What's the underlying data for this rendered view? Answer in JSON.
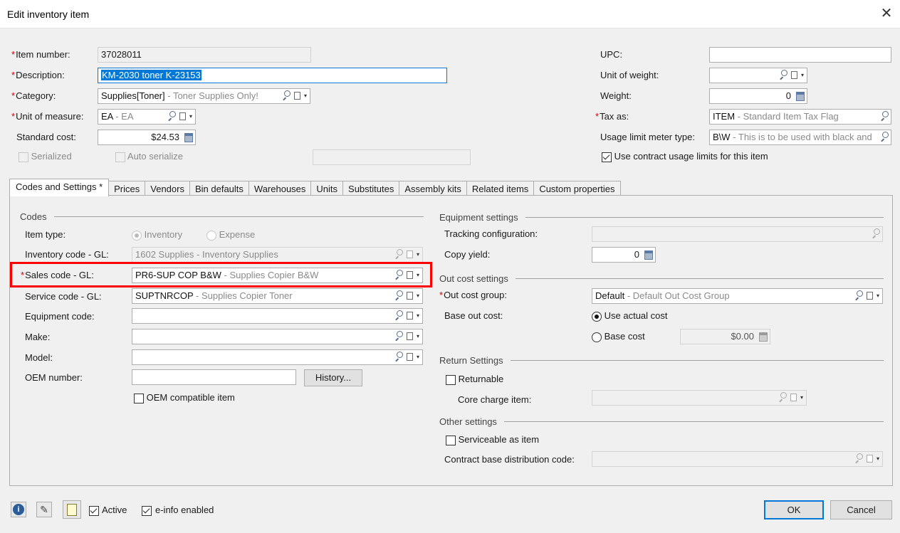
{
  "window": {
    "title": "Edit inventory item",
    "close_label": "✕"
  },
  "header": {
    "item_number": {
      "label": "Item number:",
      "value": "37028011"
    },
    "description": {
      "label": "Description:",
      "value": "KM-2030 toner  K-23153"
    },
    "category": {
      "label": "Category:",
      "code": "Supplies[Toner]",
      "desc": " - Toner Supplies Only!"
    },
    "unit_of_measure": {
      "label": "Unit of measure:",
      "code": "EA",
      "desc": " - EA"
    },
    "standard_cost": {
      "label": "Standard cost:",
      "value": "$24.53"
    },
    "serialized": {
      "label": "Serialized"
    },
    "auto_serialize": {
      "label": "Auto serialize"
    },
    "upc": {
      "label": "UPC:",
      "value": ""
    },
    "unit_of_weight": {
      "label": "Unit of weight:",
      "value": ""
    },
    "weight": {
      "label": "Weight:",
      "value": "0"
    },
    "tax_as": {
      "label": "Tax as:",
      "code": "ITEM",
      "desc": " - Standard Item Tax Flag"
    },
    "usage_limit_meter_type": {
      "label": "Usage limit meter type:",
      "code": "B\\W",
      "desc": " - This is to be used with black and"
    },
    "use_contract_usage": {
      "label": "Use contract usage limits for this item",
      "checked": true
    }
  },
  "tabs": [
    {
      "label": "Codes and Settings *",
      "active": true
    },
    {
      "label": "Prices"
    },
    {
      "label": "Vendors"
    },
    {
      "label": "Bin defaults"
    },
    {
      "label": "Warehouses"
    },
    {
      "label": "Units"
    },
    {
      "label": "Substitutes"
    },
    {
      "label": "Assembly kits"
    },
    {
      "label": "Related items"
    },
    {
      "label": "Custom properties"
    }
  ],
  "codes": {
    "group_label": "Codes",
    "item_type": {
      "label": "Item type:",
      "inventory": "Inventory",
      "expense": "Expense"
    },
    "inventory_code": {
      "label": "Inventory code - GL:",
      "code": "1602 Supplies",
      "desc": " - Inventory Supplies"
    },
    "sales_code": {
      "label": "Sales code - GL:",
      "code": "PR6-SUP COP B&W",
      "desc": " - Supplies Copier B&W"
    },
    "service_code": {
      "label": "Service code - GL:",
      "code": "SUPTNRCOP",
      "desc": " - Supplies Copier Toner"
    },
    "equipment_code": {
      "label": "Equipment code:",
      "value": ""
    },
    "make": {
      "label": "Make:",
      "value": ""
    },
    "model": {
      "label": "Model:",
      "value": ""
    },
    "oem_number": {
      "label": "OEM number:",
      "value": ""
    },
    "history_button": "History...",
    "oem_compatible": {
      "label": "OEM compatible item",
      "checked": false
    }
  },
  "equipment": {
    "group_label": "Equipment settings",
    "tracking_configuration": {
      "label": "Tracking configuration:",
      "value": ""
    },
    "copy_yield": {
      "label": "Copy yield:",
      "value": "0"
    }
  },
  "out_cost": {
    "group_label": "Out cost settings",
    "out_cost_group": {
      "label": "Out cost group:",
      "code": "Default",
      "desc": " - Default Out Cost Group"
    },
    "base_out_cost": {
      "label": "Base out cost:"
    },
    "use_actual_cost": {
      "label": "Use actual cost",
      "selected": true
    },
    "base_cost": {
      "label": "Base cost",
      "value": "$0.00"
    }
  },
  "return_settings": {
    "group_label": "Return Settings",
    "returnable": {
      "label": "Returnable",
      "checked": false
    },
    "core_charge_item": {
      "label": "Core charge item:",
      "value": ""
    }
  },
  "other_settings": {
    "group_label": "Other settings",
    "serviceable": {
      "label": "Serviceable as item",
      "checked": false
    },
    "contract_base_distribution": {
      "label": "Contract base distribution code:",
      "value": ""
    }
  },
  "footer": {
    "active": {
      "label": "Active",
      "checked": true
    },
    "einfo": {
      "label": "e-info enabled",
      "checked": true
    },
    "ok": "OK",
    "cancel": "Cancel"
  },
  "colors": {
    "required": "#d00000",
    "highlight": "#ff0000",
    "selection": "#0078d7"
  }
}
